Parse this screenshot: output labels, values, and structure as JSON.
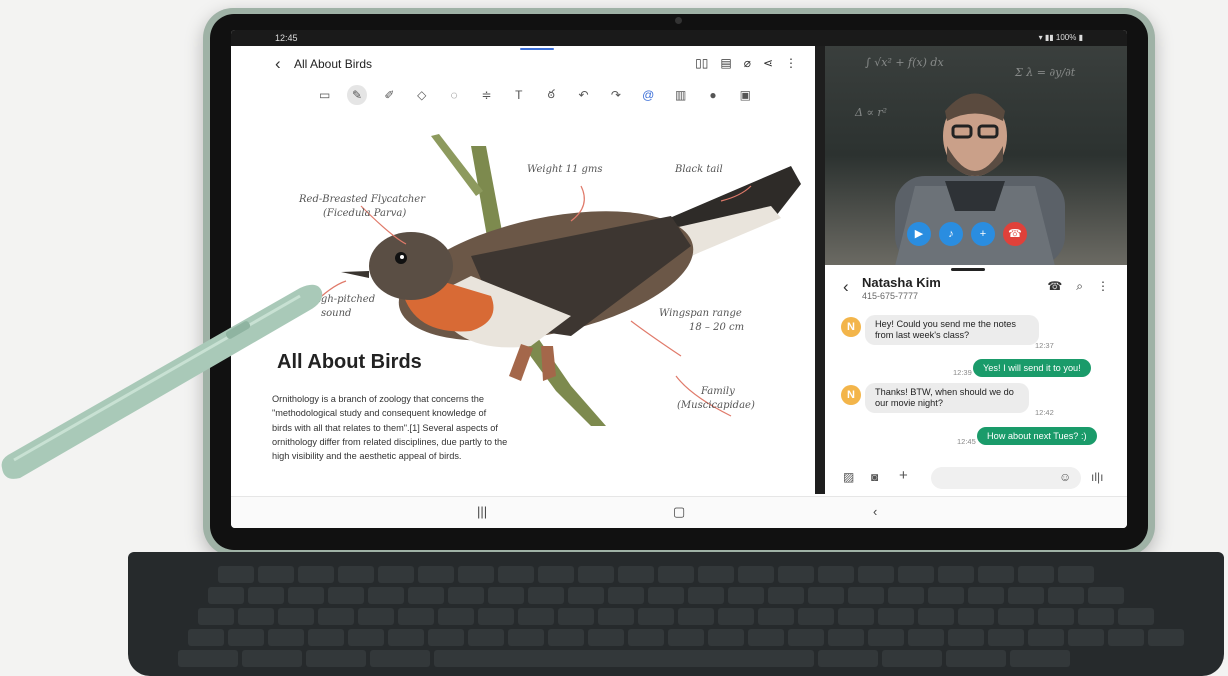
{
  "status_bar": {
    "time": "12:45",
    "system": "100%"
  },
  "notes": {
    "title": "All About Birds",
    "toolbar_icons": [
      "keyboard-icon",
      "pen-icon",
      "highlighter-icon",
      "eraser-icon",
      "lasso-icon",
      "text-style-icon",
      "text-size-icon",
      "ink-icon",
      "undo-icon",
      "redo-icon",
      "pen-settings-icon",
      "insert-icon",
      "shapes-icon",
      "template-icon"
    ],
    "header_icons": [
      "book-icon",
      "page-icon",
      "attach-icon",
      "share-icon",
      "more-icon"
    ],
    "annotations": {
      "red_breasted": "Red-Breasted Flycatcher",
      "latin": "(Ficedula Parva)",
      "weight": "Weight 11 gms",
      "tail": "Black tail",
      "pitched": "High-pitched",
      "sound": "sound",
      "wingspan": "Wingspan range",
      "wingspan_val": "18 – 20 cm",
      "family": "Family",
      "family_val": "(Muscicapidae)"
    },
    "article_title": "All About Birds",
    "article_body": "Ornithology is a branch of zoology that concerns the \"methodological study and consequent knowledge of birds with all that relates to them\".[1] Several aspects of ornithology differ from related disciplines, due partly to the high visibility and the aesthetic appeal of birds."
  },
  "chat": {
    "contact_name": "Natasha Kim",
    "contact_number": "415-675-7777",
    "avatar_letter": "N",
    "messages": [
      {
        "dir": "in",
        "line1": "Hey! Could you send me the notes",
        "line2": "from last week's class?",
        "time": "12:37"
      },
      {
        "dir": "out",
        "text": "Yes! I will send it to you!",
        "time": "12:39"
      },
      {
        "dir": "in",
        "line1": "Thanks! BTW, when should we do",
        "line2": "our movie night?",
        "time": "12:42"
      },
      {
        "dir": "out",
        "text": "How about next Tues? :)",
        "time": "12:45"
      }
    ]
  },
  "colors": {
    "accent": "#3c6fd8",
    "sent_bubble": "#1a9b6a",
    "avatar": "#f3b54a",
    "end_call": "#e0413a",
    "call_button": "#2a8de0"
  }
}
